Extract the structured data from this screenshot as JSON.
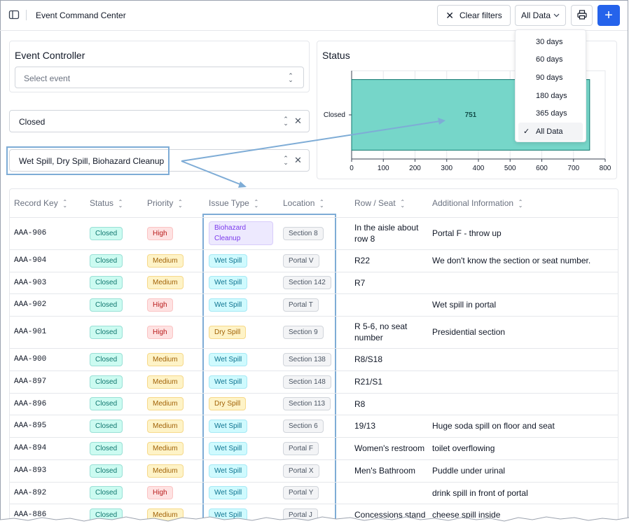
{
  "header": {
    "title": "Event Command Center",
    "clear_filters_label": "Clear filters",
    "range_label": "All Data",
    "add_label": "+"
  },
  "range_menu": {
    "options": [
      "30 days",
      "60 days",
      "90 days",
      "180 days",
      "365 days",
      "All Data"
    ],
    "selected": "All Data"
  },
  "event_controller": {
    "label": "Event Controller",
    "placeholder": "Select event"
  },
  "filters": {
    "status_value": "Closed",
    "issue_type_value": "Wet Spill, Dry Spill, Biohazard Cleanup"
  },
  "status_panel": {
    "title": "Status"
  },
  "chart_data": {
    "type": "bar",
    "orientation": "horizontal",
    "title": "Status",
    "categories": [
      "Closed"
    ],
    "values": [
      751
    ],
    "data_labels": [
      "751"
    ],
    "xlim": [
      0,
      800
    ],
    "xticks": [
      0,
      100,
      200,
      300,
      400,
      500,
      600,
      700,
      800
    ],
    "grid": true,
    "bar_color": "#76d6c9",
    "bar_edge_color": "#0f766e"
  },
  "table": {
    "columns": [
      "Record Key",
      "Status",
      "Priority",
      "Issue Type",
      "Location",
      "Row / Seat",
      "Additional Information"
    ],
    "rows": [
      {
        "key": "AAA-906",
        "status": "Closed",
        "priority": "High",
        "issue": "Biohazard Cleanup",
        "location": "Section 8",
        "seat": "In the aisle about row 8",
        "info": "Portal F - throw up"
      },
      {
        "key": "AAA-904",
        "status": "Closed",
        "priority": "Medium",
        "issue": "Wet Spill",
        "location": "Portal V",
        "seat": "R22",
        "info": "We don't know the section or seat number."
      },
      {
        "key": "AAA-903",
        "status": "Closed",
        "priority": "Medium",
        "issue": "Wet Spill",
        "location": "Section 142",
        "seat": "R7",
        "info": ""
      },
      {
        "key": "AAA-902",
        "status": "Closed",
        "priority": "High",
        "issue": "Wet Spill",
        "location": "Portal T",
        "seat": "",
        "info": "Wet spill in portal"
      },
      {
        "key": "AAA-901",
        "status": "Closed",
        "priority": "High",
        "issue": "Dry Spill",
        "location": "Section 9",
        "seat": "R 5-6, no seat number",
        "info": "Presidential section"
      },
      {
        "key": "AAA-900",
        "status": "Closed",
        "priority": "Medium",
        "issue": "Wet Spill",
        "location": "Section 138",
        "seat": "R8/S18",
        "info": ""
      },
      {
        "key": "AAA-897",
        "status": "Closed",
        "priority": "Medium",
        "issue": "Wet Spill",
        "location": "Section 148",
        "seat": "R21/S1",
        "info": ""
      },
      {
        "key": "AAA-896",
        "status": "Closed",
        "priority": "Medium",
        "issue": "Dry Spill",
        "location": "Section 113",
        "seat": "R8",
        "info": ""
      },
      {
        "key": "AAA-895",
        "status": "Closed",
        "priority": "Medium",
        "issue": "Wet Spill",
        "location": "Section 6",
        "seat": "19/13",
        "info": "Huge soda spill on floor and seat"
      },
      {
        "key": "AAA-894",
        "status": "Closed",
        "priority": "Medium",
        "issue": "Wet Spill",
        "location": "Portal F",
        "seat": "Women's restroom",
        "info": "toilet overflowing"
      },
      {
        "key": "AAA-893",
        "status": "Closed",
        "priority": "Medium",
        "issue": "Wet Spill",
        "location": "Portal X",
        "seat": "Men's Bathroom",
        "info": "Puddle under urinal"
      },
      {
        "key": "AAA-892",
        "status": "Closed",
        "priority": "High",
        "issue": "Wet Spill",
        "location": "Portal Y",
        "seat": "",
        "info": "drink spill in front of portal"
      },
      {
        "key": "AAA-886",
        "status": "Closed",
        "priority": "Medium",
        "issue": "Wet Spill",
        "location": "Portal J",
        "seat": "Concessions stand",
        "info": "cheese spill inside"
      }
    ]
  },
  "colors": {
    "accent": "#2563eb",
    "annotation": "#7eacd6"
  }
}
